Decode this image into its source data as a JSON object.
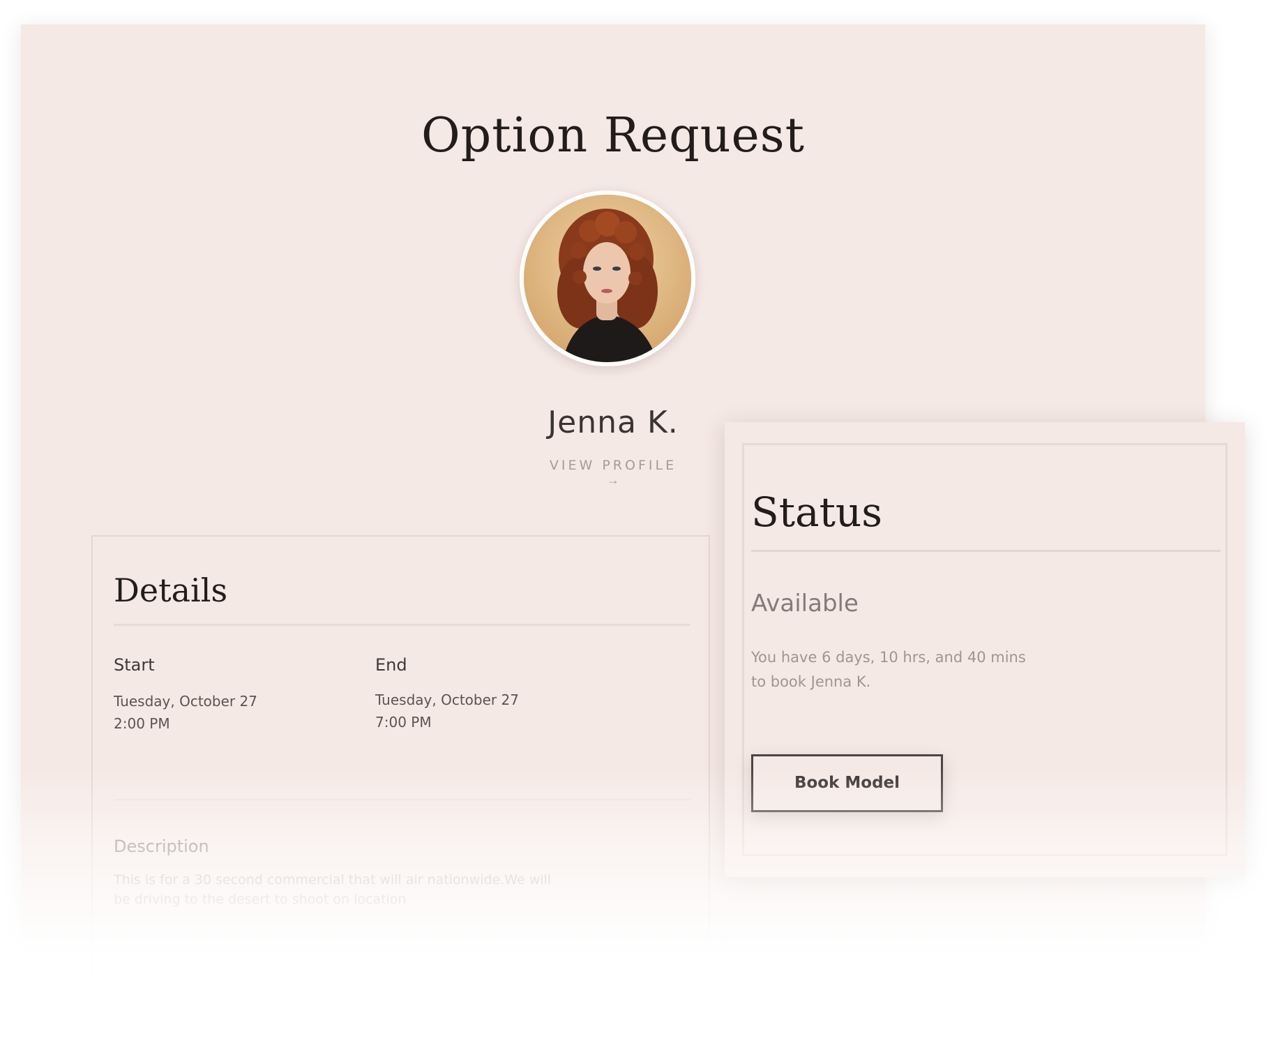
{
  "page": {
    "title": "Option Request"
  },
  "model": {
    "name": "Jenna K.",
    "view_profile_label": "VIEW PROFILE",
    "view_profile_arrow": "→"
  },
  "details": {
    "title": "Details",
    "start": {
      "label": "Start",
      "date": "Tuesday, October 27",
      "time": "2:00 PM"
    },
    "end": {
      "label": "End",
      "date": "Tuesday, October 27",
      "time": "7:00 PM"
    },
    "description": {
      "label": "Description",
      "line1": "This is for a 30 second commercial that will air  nationwide.We will",
      "line2": "be driving to the desert to shoot on location"
    }
  },
  "status": {
    "title": "Status",
    "value": "Available",
    "message_line1": "You have 6 days, 10 hrs, and 40 mins",
    "message_line2": "to book Jenna K.",
    "book_button_label": "Book Model"
  },
  "colors": {
    "card_background": "#f5e9e5",
    "heading_text": "#221d1b",
    "muted_text": "#a1958f",
    "button_border": "#4a4442"
  }
}
